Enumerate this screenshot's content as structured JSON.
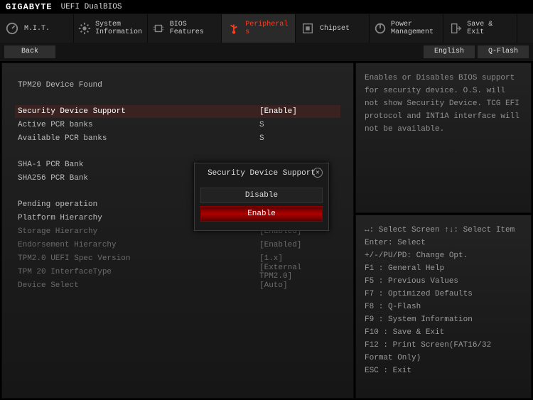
{
  "topbar": {
    "brand": "GIGABYTE",
    "bios": "UEFI DualBIOS"
  },
  "tabs": [
    {
      "label": "M.I.T."
    },
    {
      "label": "System Information"
    },
    {
      "label": "BIOS Features"
    },
    {
      "label": "Peripherals"
    },
    {
      "label": "Chipset"
    },
    {
      "label": "Power Management"
    },
    {
      "label": "Save & Exit"
    }
  ],
  "subbar": {
    "back": "Back",
    "lang": "English",
    "qflash": "Q-Flash"
  },
  "main": {
    "header": "TPM20 Device Found",
    "rows": [
      {
        "name": "Security Device Support",
        "val": "[Enable]",
        "sel": true
      },
      {
        "name": "Active PCR banks",
        "val": "S"
      },
      {
        "name": "Available PCR banks",
        "val": "S"
      },
      {
        "gap": true
      },
      {
        "name": "SHA-1 PCR Bank",
        "val": ""
      },
      {
        "name": "SHA256 PCR Bank",
        "val": ""
      },
      {
        "gap": true
      },
      {
        "name": "Pending operation",
        "val": ""
      },
      {
        "name": "Platform Hierarchy",
        "val": ""
      },
      {
        "name": "Storage Hierarchy",
        "val": "[Enabled]",
        "dim": true
      },
      {
        "name": "Endorsement Hierarchy",
        "val": "[Enabled]",
        "dim": true
      },
      {
        "name": "TPM2.0 UEFI Spec Version",
        "val": "[1.x]",
        "dim": true
      },
      {
        "name": "TPM 20 InterfaceType",
        "val": "[External TPM2.0]",
        "dim": true
      },
      {
        "name": "Device Select",
        "val": "[Auto]",
        "dim": true
      }
    ]
  },
  "help": "Enables or Disables BIOS support for security device. O.S. will not show Security Device. TCG EFI protocol and INT1A interface will not be available.",
  "keys": [
    "↔: Select Screen  ↑↓: Select Item",
    "Enter: Select",
    "+/-/PU/PD: Change Opt.",
    "F1  : General Help",
    "F5  : Previous Values",
    "F7  : Optimized Defaults",
    "F8  : Q-Flash",
    "F9  : System Information",
    "F10 : Save & Exit",
    "F12 : Print Screen(FAT16/32 Format Only)",
    "ESC : Exit"
  ],
  "popup": {
    "title": "Security Device Support",
    "options": [
      "Disable",
      "Enable"
    ],
    "selected": 1
  }
}
